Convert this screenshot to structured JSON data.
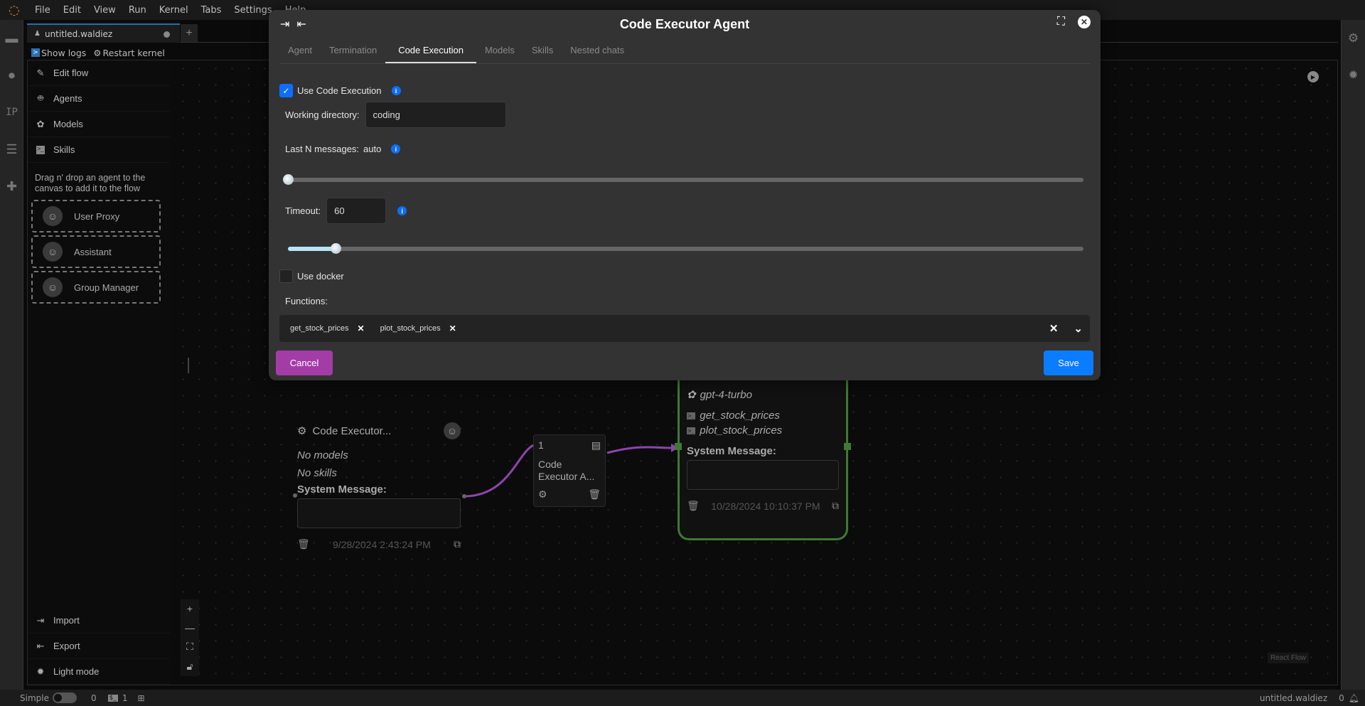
{
  "menubar": {
    "items": [
      "File",
      "Edit",
      "View",
      "Run",
      "Kernel",
      "Tabs",
      "Settings",
      "Help"
    ]
  },
  "document_tab": {
    "title": "untitled.waldiez",
    "add_label": "+"
  },
  "toolbar": {
    "show_logs": "Show logs",
    "restart_kernel": "Restart kernel"
  },
  "left_strip": {
    "ip_label": "IP"
  },
  "sidebar": {
    "items": [
      {
        "label": "Edit flow",
        "icon": "edit-icon"
      },
      {
        "label": "Agents",
        "icon": "robot-icon"
      },
      {
        "label": "Models",
        "icon": "openai-icon"
      },
      {
        "label": "Skills",
        "icon": "terminal-icon"
      }
    ],
    "help_text": "Drag n' drop an agent to the canvas to add it to the flow",
    "agents": [
      {
        "label": "User Proxy"
      },
      {
        "label": "Assistant"
      },
      {
        "label": "Group Manager"
      }
    ],
    "bottom_items": [
      {
        "label": "Import"
      },
      {
        "label": "Export"
      },
      {
        "label": "Light mode"
      }
    ]
  },
  "canvas": {
    "node1": {
      "title": "Code Executor...",
      "models": "No models",
      "skills": "No skills",
      "system_message_label": "System Message:",
      "timestamp": "9/28/2024 2:43:24 PM"
    },
    "edge_card": {
      "order": "1",
      "label": "Code Executor A..."
    },
    "node2": {
      "model": "gpt-4-turbo",
      "skills": [
        "get_stock_prices",
        "plot_stock_prices"
      ],
      "system_message_label": "System Message:",
      "timestamp": "10/28/2024 10:10:37 PM"
    },
    "attribution": "React Flow",
    "edge_color": "#8e44ad",
    "node2_border_color": "#3e7a32"
  },
  "modal": {
    "title": "Code Executor Agent",
    "tabs": [
      {
        "label": "Agent",
        "active": false
      },
      {
        "label": "Termination",
        "active": false
      },
      {
        "label": "Code Execution",
        "active": true
      },
      {
        "label": "Models",
        "active": false
      },
      {
        "label": "Skills",
        "active": false
      },
      {
        "label": "Nested chats",
        "active": false
      }
    ],
    "use_code_execution": {
      "label": "Use Code Execution",
      "checked": true
    },
    "working_directory": {
      "label": "Working directory:",
      "value": "coding"
    },
    "last_n_messages": {
      "label": "Last N messages:",
      "value": "auto",
      "slider_fraction": 0.0
    },
    "timeout": {
      "label": "Timeout:",
      "value": "60",
      "slider_fraction": 0.06
    },
    "use_docker": {
      "label": "Use docker",
      "checked": false
    },
    "functions": {
      "label": "Functions:",
      "selected": [
        "get_stock_prices",
        "plot_stock_prices"
      ]
    },
    "cancel_label": "Cancel",
    "save_label": "Save",
    "accent": "#0a7cff",
    "cancel_color": "#a43ca8"
  },
  "statusbar": {
    "mode_label": "Simple",
    "count_a": "0",
    "count_b": "1",
    "filename": "untitled.waldiez",
    "notifications": "0"
  }
}
